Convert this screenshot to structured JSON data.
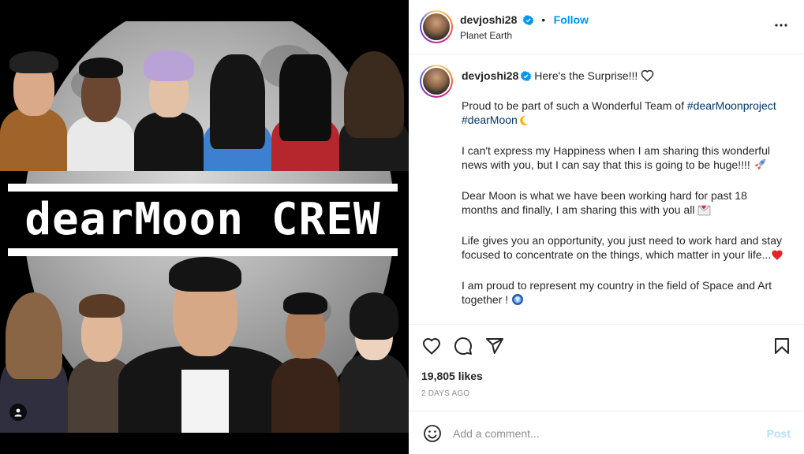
{
  "media": {
    "banner_text": "dearMoon CREW",
    "tagged_icon": "user-icon"
  },
  "header": {
    "username": "devjoshi28",
    "verified_icon": "verified-badge-icon",
    "separator": "•",
    "follow_label": "Follow",
    "location": "Planet Earth",
    "more_icon": "more-options-icon"
  },
  "caption": {
    "username": "devjoshi28",
    "headline": "Here's the Surprise!!!",
    "paragraphs": {
      "p1_text": "Proud to be part of such a Wonderful Team of ",
      "p1_tag1": "#dearMoonproject",
      "p1_tag2": "#dearMoon",
      "p2": "I can't express my Happiness when I am sharing this wonderful news with you, but I can say that this is going to be huge!!!! ",
      "p3": "Dear Moon is what we have been working hard for past 18 months and finally, I am sharing this with you all ",
      "p4": "Life gives you an opportunity, you just need to work hard and stay focused to concentrate on the things, which matter in your life...",
      "p5": "I am proud to represent my country in the field of Space and Art together ! "
    }
  },
  "actions": {
    "like_icon": "heart-icon",
    "comment_icon": "comment-icon",
    "share_icon": "share-icon",
    "save_icon": "bookmark-icon",
    "likes": "19,805 likes",
    "timestamp": "2 DAYS AGO"
  },
  "comment_box": {
    "emoji_icon": "smiley-icon",
    "placeholder": "Add a comment...",
    "post_label": "Post"
  },
  "colors": {
    "link_blue": "#0095f6",
    "hashtag": "#00376b",
    "post_disabled": "#b2dffc",
    "muted": "#8e8e8e"
  }
}
